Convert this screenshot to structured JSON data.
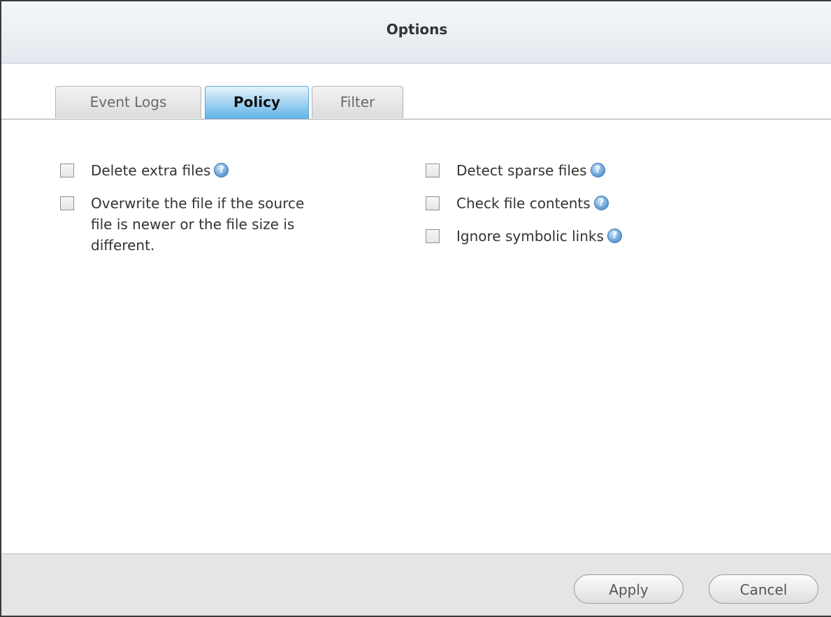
{
  "dialog": {
    "title": "Options"
  },
  "tabs": [
    {
      "label": "Event Logs",
      "active": false
    },
    {
      "label": "Policy",
      "active": true
    },
    {
      "label": "Filter",
      "active": false
    }
  ],
  "policy": {
    "left": [
      {
        "label": "Delete extra files",
        "checked": false,
        "has_help": true
      },
      {
        "label": "Overwrite the file if the source\nfile is newer or the file size is\ndifferent.",
        "checked": false,
        "has_help": false
      }
    ],
    "right": [
      {
        "label": "Detect sparse files",
        "checked": false,
        "has_help": true
      },
      {
        "label": "Check file contents",
        "checked": false,
        "has_help": true
      },
      {
        "label": "Ignore symbolic links",
        "checked": false,
        "has_help": true
      }
    ]
  },
  "footer": {
    "apply_label": "Apply",
    "cancel_label": "Cancel"
  },
  "icons": {
    "help": "help-icon"
  },
  "colors": {
    "active_tab": "#5fb2e6",
    "help_icon": "#6fa8dc",
    "footer_bg": "#e5e5e5"
  }
}
